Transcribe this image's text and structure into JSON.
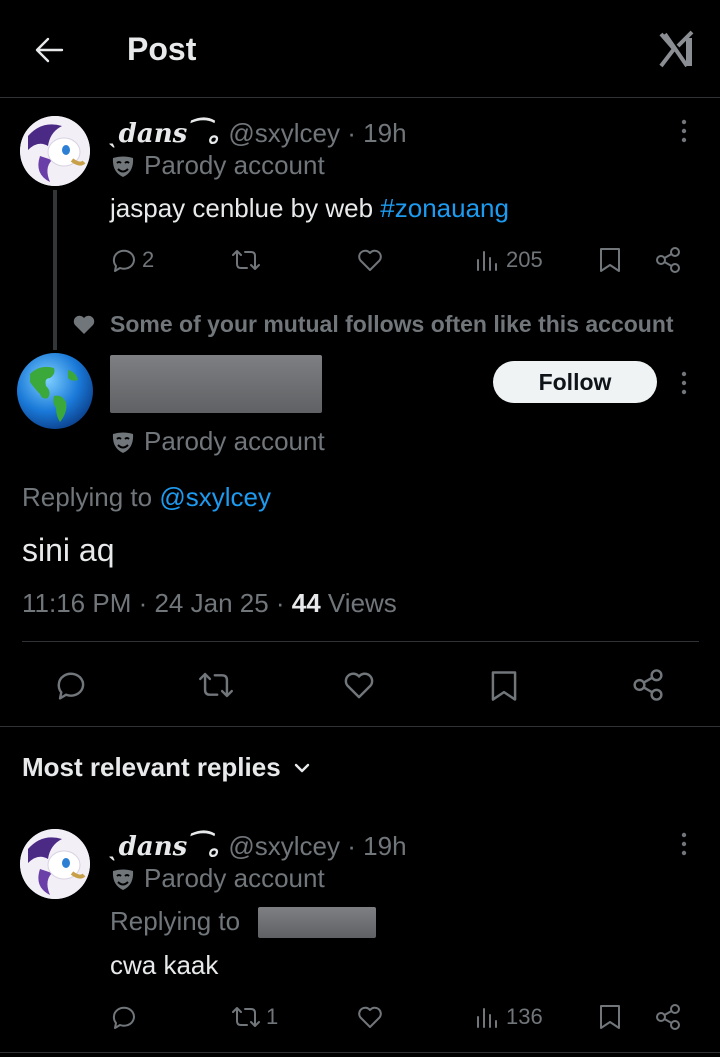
{
  "header": {
    "title": "Post",
    "back_icon": "arrow-left-icon",
    "logo_icon": "x-logo-icon"
  },
  "parent_post": {
    "display_name": "dans",
    "handle": "@sxylcey",
    "time": "· 19h",
    "badge": "Parody account",
    "text_plain": "jaspay cenblue by web ",
    "hashtag": "#zonauang",
    "reply_count": "2",
    "repost_count": "",
    "views": "205"
  },
  "social_context": "Some of your mutual follows often like this account",
  "main_post": {
    "badge": "Parody account",
    "follow_label": "Follow",
    "replying_label": "Replying to ",
    "replying_handle": "@sxylcey",
    "text": "sini aq",
    "time": "11:16 PM · 24 Jan 25 · ",
    "views_count": "44",
    "views_label": " Views"
  },
  "replies_header": "Most relevant replies",
  "reply": {
    "display_name": "dans",
    "handle": "@sxylcey",
    "time": "· 19h",
    "badge": "Parody account",
    "replying_label": "Replying to",
    "text": "cwa kaak",
    "repost_count": "1",
    "views": "136"
  },
  "colors": {
    "background": "#000000",
    "text": "#e7e9ea",
    "muted": "#71767b",
    "link": "#1d9bf0",
    "divider": "#2f3336"
  }
}
